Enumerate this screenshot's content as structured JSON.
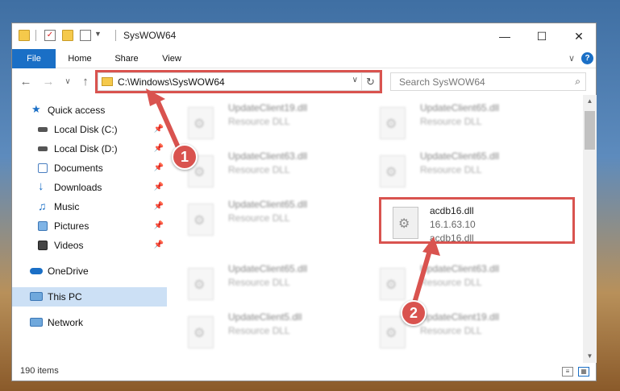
{
  "window": {
    "title": "SysWOW64",
    "minimize": "—",
    "maximize": "☐",
    "close": "✕"
  },
  "ribbon": {
    "tabs": [
      "File",
      "Home",
      "Share",
      "View"
    ],
    "expand": "∨",
    "help": "?"
  },
  "nav": {
    "back": "←",
    "forward": "→",
    "recent": "∨",
    "up": "↑",
    "address": "C:\\Windows\\SysWOW64",
    "address_dropdown": "∨",
    "refresh": "↻",
    "search_placeholder": "Search SysWOW64",
    "search_icon": "⌕"
  },
  "sidebar": {
    "items": [
      {
        "label": "Quick access",
        "icon": "star-icon",
        "pinned": false
      },
      {
        "label": "Local Disk (C:)",
        "icon": "drive-icon",
        "pinned": true
      },
      {
        "label": "Local Disk (D:)",
        "icon": "drive-icon",
        "pinned": true
      },
      {
        "label": "Documents",
        "icon": "documents-icon",
        "pinned": true
      },
      {
        "label": "Downloads",
        "icon": "download-icon",
        "pinned": true
      },
      {
        "label": "Music",
        "icon": "music-icon",
        "pinned": true
      },
      {
        "label": "Pictures",
        "icon": "pictures-icon",
        "pinned": true
      },
      {
        "label": "Videos",
        "icon": "videos-icon",
        "pinned": true
      },
      {
        "label": "OneDrive",
        "icon": "cloud-icon",
        "pinned": false
      },
      {
        "label": "This PC",
        "icon": "computer-icon",
        "pinned": false,
        "selected": true
      },
      {
        "label": "Network",
        "icon": "network-icon",
        "pinned": false
      }
    ],
    "pin_glyph": "📌"
  },
  "files": [
    {
      "name": "UpdateClient19.dll",
      "type": "Resource DLL",
      "blurred": true
    },
    {
      "name": "UpdateClient65.dll",
      "type": "Resource DLL",
      "blurred": true
    },
    {
      "name": "UpdateClient63.dll",
      "type": "Resource DLL",
      "blurred": true
    },
    {
      "name": "UpdateClient65.dll",
      "type": "Resource DLL",
      "blurred": true
    },
    {
      "name": "UpdateClient65.dll",
      "type": "Resource DLL",
      "blurred": true
    },
    {
      "name": "acdb16.dll",
      "version": "16.1.63.10",
      "type": "acdb16.dll",
      "blurred": false
    },
    {
      "name": "UpdateClient65.dll",
      "type": "Resource DLL",
      "blurred": true
    },
    {
      "name": "UpdateClient63.dll",
      "type": "Resource DLL",
      "blurred": true
    },
    {
      "name": "UpdateClient5.dll",
      "type": "Resource DLL",
      "blurred": true
    },
    {
      "name": "UpdateClient19.dll",
      "type": "Resource DLL",
      "blurred": true
    }
  ],
  "status": {
    "item_count": "190 items"
  },
  "annotations": {
    "callout_1": "1",
    "callout_2": "2",
    "highlight_color": "#d9534f"
  }
}
